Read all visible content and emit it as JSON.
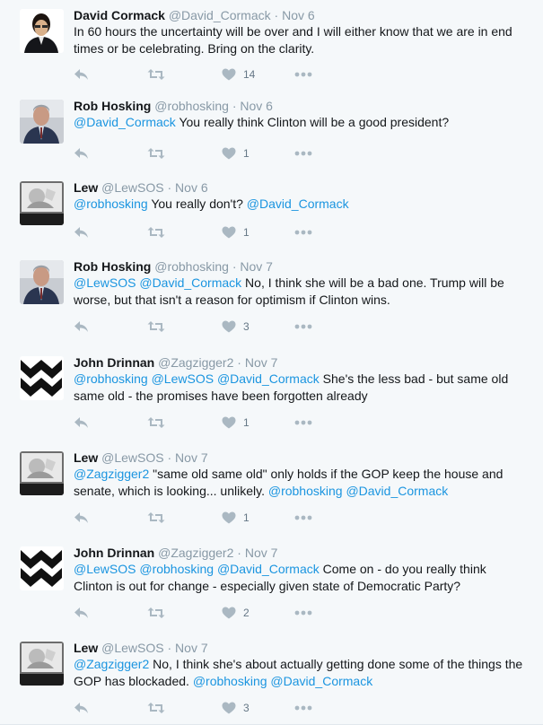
{
  "tweets": [
    {
      "name": "David Cormack",
      "handle": "@David_Cormack",
      "date": "Nov 6",
      "avatar": "david",
      "segments": [
        {
          "t": "In 60 hours the uncertainty will be over and I will either know that we are in end times or be celebrating. Bring on the clarity.",
          "m": false
        }
      ],
      "likes": "14"
    },
    {
      "name": "Rob Hosking",
      "handle": "@robhosking",
      "date": "Nov 6",
      "avatar": "rob",
      "segments": [
        {
          "t": "@David_Cormack",
          "m": true
        },
        {
          "t": " You really think Clinton will be a good president?",
          "m": false
        }
      ],
      "likes": "1"
    },
    {
      "name": "Lew",
      "handle": "@LewSOS",
      "date": "Nov 6",
      "avatar": "lew",
      "segments": [
        {
          "t": "@robhosking",
          "m": true
        },
        {
          "t": " You really don't? ",
          "m": false
        },
        {
          "t": "@David_Cormack",
          "m": true
        }
      ],
      "likes": "1"
    },
    {
      "name": "Rob Hosking",
      "handle": "@robhosking",
      "date": "Nov 7",
      "avatar": "rob",
      "segments": [
        {
          "t": "@LewSOS",
          "m": true
        },
        {
          "t": " ",
          "m": false
        },
        {
          "t": "@David_Cormack",
          "m": true
        },
        {
          "t": " No, I think she will be a bad one. Trump will be worse, but that isn't a reason for optimism if Clinton wins.",
          "m": false
        }
      ],
      "likes": "3"
    },
    {
      "name": "John Drinnan",
      "handle": "@Zagzigger2",
      "date": "Nov 7",
      "avatar": "john",
      "segments": [
        {
          "t": "@robhosking",
          "m": true
        },
        {
          "t": " ",
          "m": false
        },
        {
          "t": "@LewSOS",
          "m": true
        },
        {
          "t": " ",
          "m": false
        },
        {
          "t": "@David_Cormack",
          "m": true
        },
        {
          "t": " She's the less bad - but same old same old - the promises have been forgotten already",
          "m": false
        }
      ],
      "likes": "1"
    },
    {
      "name": "Lew",
      "handle": "@LewSOS",
      "date": "Nov 7",
      "avatar": "lew",
      "segments": [
        {
          "t": "@Zagzigger2",
          "m": true
        },
        {
          "t": " \"same old same old\" only holds if the GOP keep the house and senate, which is looking... unlikely. ",
          "m": false
        },
        {
          "t": "@robhosking",
          "m": true
        },
        {
          "t": " ",
          "m": false
        },
        {
          "t": "@David_Cormack",
          "m": true
        }
      ],
      "likes": "1"
    },
    {
      "name": "John Drinnan",
      "handle": "@Zagzigger2",
      "date": "Nov 7",
      "avatar": "john",
      "segments": [
        {
          "t": "@LewSOS",
          "m": true
        },
        {
          "t": " ",
          "m": false
        },
        {
          "t": "@robhosking",
          "m": true
        },
        {
          "t": " ",
          "m": false
        },
        {
          "t": "@David_Cormack",
          "m": true
        },
        {
          "t": " Come on - do you really think Clinton is out for change - especially given state of Democratic Party?",
          "m": false
        }
      ],
      "likes": "2"
    },
    {
      "name": "Lew",
      "handle": "@LewSOS",
      "date": "Nov 7",
      "avatar": "lew",
      "segments": [
        {
          "t": "@Zagzigger2",
          "m": true
        },
        {
          "t": " No, I think she's about actually getting done some of the things the GOP has blockaded. ",
          "m": false
        },
        {
          "t": "@robhosking",
          "m": true
        },
        {
          "t": " ",
          "m": false
        },
        {
          "t": "@David_Cormack",
          "m": true
        }
      ],
      "likes": "3"
    }
  ],
  "icons": {
    "reply": "reply-icon",
    "retweet": "retweet-icon",
    "like": "heart-icon",
    "more": "more-icon"
  },
  "colors": {
    "mention": "#1b95e0",
    "meta": "#8899a6",
    "icon": "#aab8c2",
    "background": "#f5f8fa"
  }
}
